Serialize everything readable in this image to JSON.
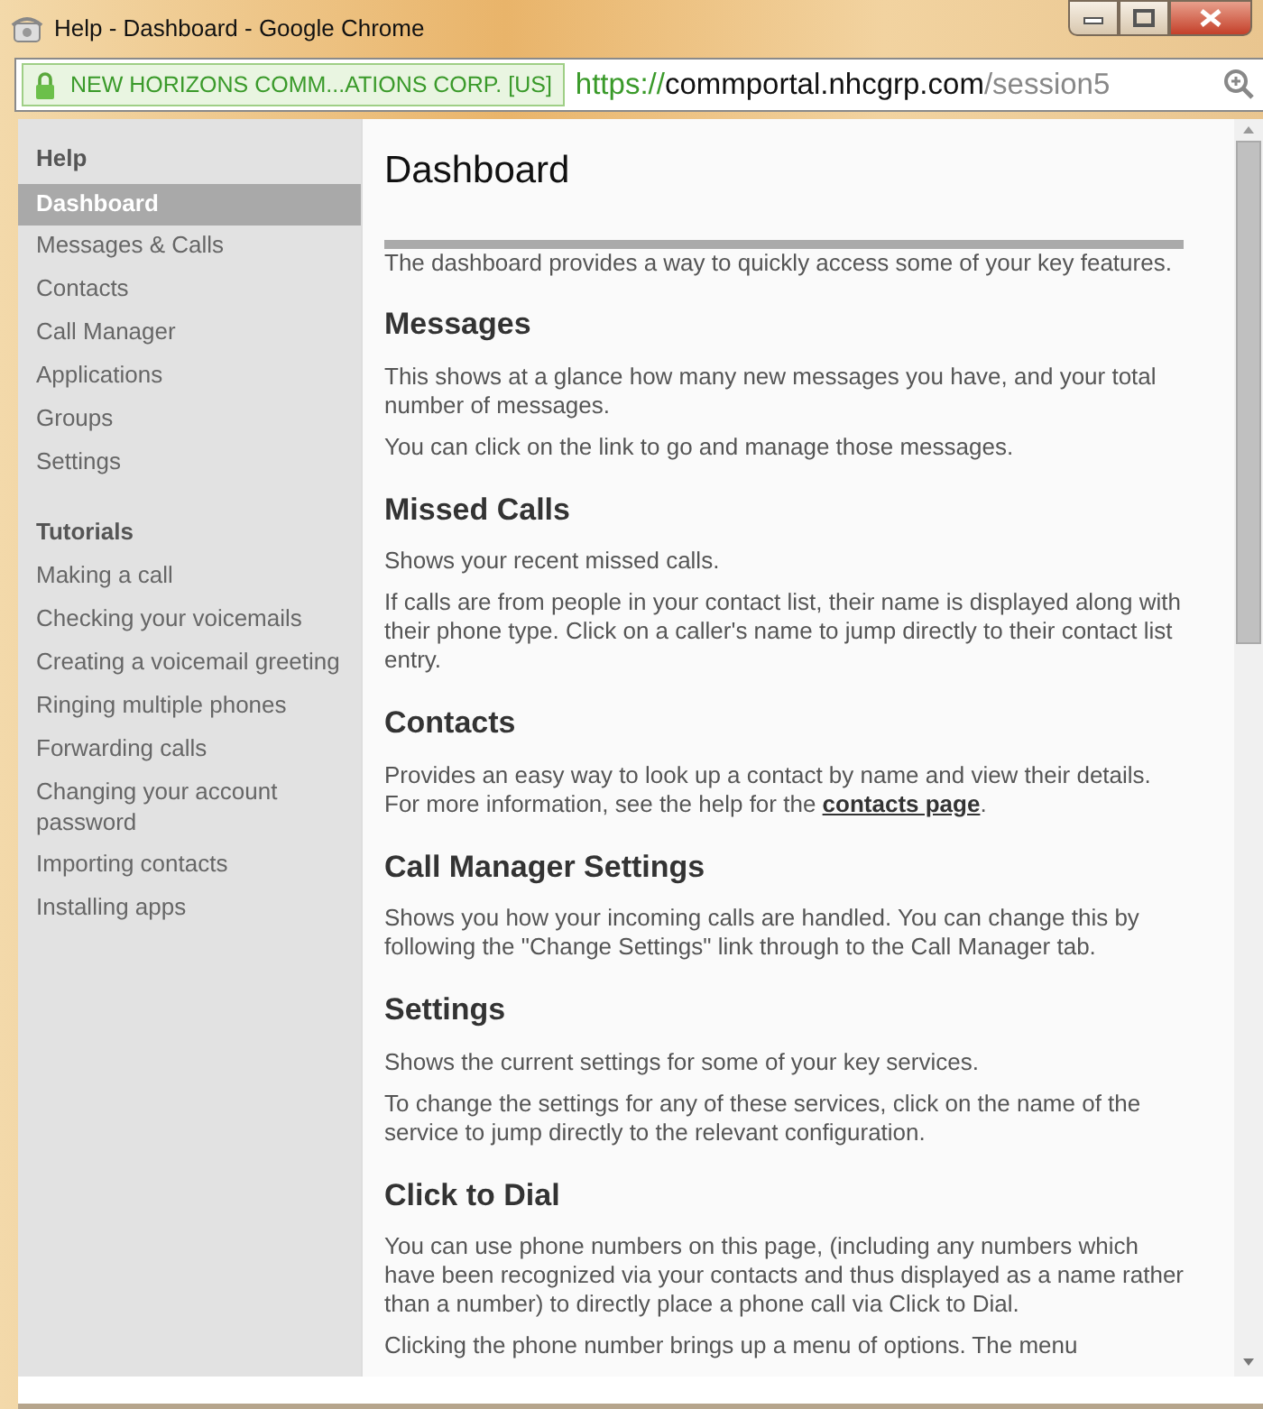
{
  "window": {
    "title": "Help - Dashboard - Google Chrome"
  },
  "address_bar": {
    "security_badge": "NEW HORIZONS COMM...ATIONS CORP. [US]",
    "scheme": "https://",
    "host": "commportal.nhcgrp.com",
    "path": "/session5"
  },
  "sidebar": {
    "sections": [
      {
        "heading": "Help",
        "items": [
          {
            "label": "Dashboard",
            "selected": true
          },
          {
            "label": "Messages & Calls",
            "selected": false
          },
          {
            "label": "Contacts",
            "selected": false
          },
          {
            "label": "Call Manager",
            "selected": false
          },
          {
            "label": "Applications",
            "selected": false
          },
          {
            "label": "Groups",
            "selected": false
          },
          {
            "label": "Settings",
            "selected": false
          }
        ]
      },
      {
        "heading": "Tutorials",
        "items": [
          {
            "label": "Making a call",
            "selected": false
          },
          {
            "label": "Checking your voicemails",
            "selected": false
          },
          {
            "label": "Creating a voicemail greeting",
            "selected": false
          },
          {
            "label": "Ringing multiple phones",
            "selected": false
          },
          {
            "label": "Forwarding calls",
            "selected": false
          },
          {
            "label": "Changing your account password",
            "selected": false
          },
          {
            "label": "Importing contacts",
            "selected": false
          },
          {
            "label": "Installing apps",
            "selected": false
          }
        ]
      }
    ]
  },
  "content": {
    "title": "Dashboard",
    "intro": "The dashboard provides a way to quickly access some of your key features.",
    "sections": [
      {
        "heading": "Messages",
        "paragraphs": [
          "This shows at a glance how many new messages you have, and your total number of messages.",
          "You can click on the link to go and manage those messages."
        ]
      },
      {
        "heading": "Missed Calls",
        "paragraphs": [
          "Shows your recent missed calls.",
          "If calls are from people in your contact list, their name is displayed along with their phone type. Click on a caller's name to jump directly to their contact list entry."
        ]
      },
      {
        "heading": "Contacts",
        "paragraphs": [
          {
            "parts": [
              {
                "kind": "text",
                "text": "Provides an easy way to look up a contact by name and view their details. For more information, see the help for the "
              },
              {
                "kind": "link",
                "text": "contacts page"
              },
              {
                "kind": "text",
                "text": "."
              }
            ]
          }
        ]
      },
      {
        "heading": "Call Manager Settings",
        "paragraphs": [
          "Shows you how your incoming calls are handled. You can change this by following the \"Change Settings\" link through to the Call Manager tab."
        ]
      },
      {
        "heading": "Settings",
        "paragraphs": [
          "Shows the current settings for some of your key services.",
          "To change the settings for any of these services, click on the name of the service to jump directly to the relevant configuration."
        ]
      },
      {
        "heading": "Click to Dial",
        "paragraphs": [
          "You can use phone numbers on this page, (including any numbers which have been recognized via your contacts and thus displayed as a name rather than a number) to directly place a phone call via Click to Dial.",
          "Clicking the phone number brings up a menu of options. The menu"
        ]
      }
    ]
  }
}
